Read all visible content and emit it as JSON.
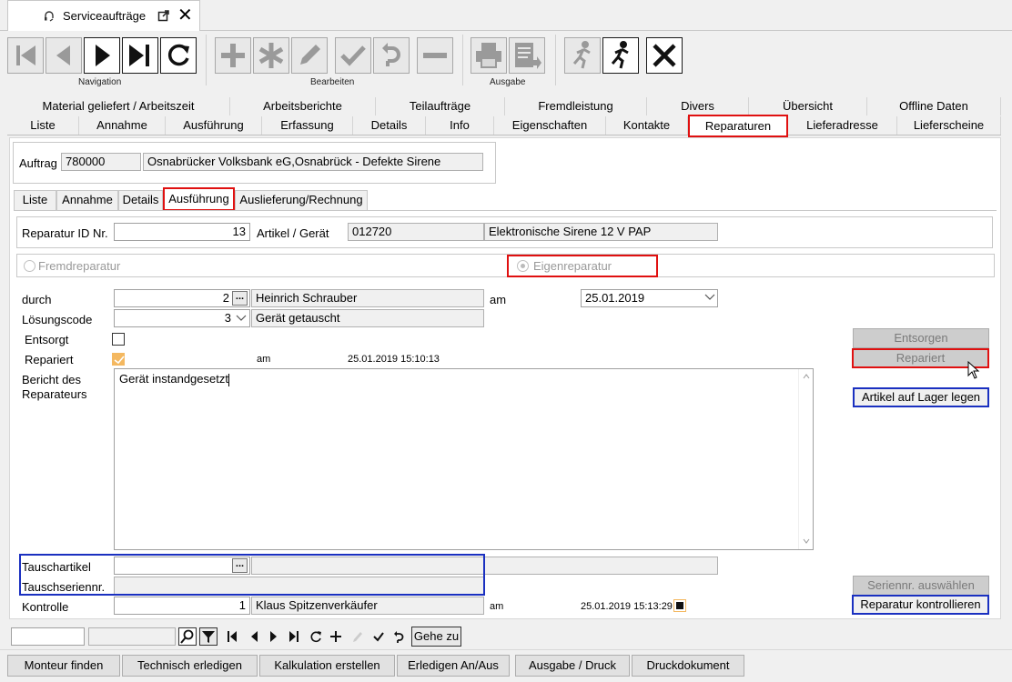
{
  "window": {
    "title": "Serviceaufträge"
  },
  "toolbar": {
    "groups": {
      "navigation": "Navigation",
      "bearbeiten": "Bearbeiten",
      "ausgabe": "Ausgabe"
    }
  },
  "tabs_row1": [
    "Material geliefert / Arbeitszeit",
    "Arbeitsberichte",
    "Teilaufträge",
    "Fremdleistung",
    "Divers",
    "Übersicht",
    "Offline Daten"
  ],
  "tabs_row2": [
    "Liste",
    "Annahme",
    "Ausführung",
    "Erfassung",
    "Details",
    "Info",
    "Eigenschaften",
    "Kontakte",
    "Reparaturen",
    "Lieferadresse",
    "Lieferscheine"
  ],
  "auftrag": {
    "label": "Auftrag",
    "nr": "780000",
    "text": "Osnabrücker Volksbank eG,Osnabrück - Defekte Sirene"
  },
  "subtabs": [
    "Liste",
    "Annahme",
    "Details",
    "Ausführung",
    "Auslieferung/Rechnung"
  ],
  "reparatur": {
    "id_label": "Reparatur ID Nr.",
    "id_value": "13",
    "artikel_label": "Artikel / Gerät",
    "artikel_nr": "012720",
    "artikel_text": "Elektronische Sirene 12 V PAP"
  },
  "radios": {
    "fremd": "Fremdreparatur",
    "eigen": "Eigenreparatur"
  },
  "form": {
    "durch_label": "durch",
    "durch_nr": "2",
    "durch_name": "Heinrich Schrauber",
    "am_label": "am",
    "am_date": "25.01.2019",
    "loesung_label": "Lösungscode",
    "loesung_nr": "3",
    "loesung_text": "Gerät getauscht",
    "entsorgt_label": "Entsorgt",
    "repariert_label": "Repariert",
    "repariert_am_label": "am",
    "repariert_am": "25.01.2019 15:10:13",
    "bericht_label1": "Bericht des",
    "bericht_label2": "Reparateurs",
    "bericht_text": "Gerät instandgesetzt",
    "tausch_label": "Tauschartikel",
    "tauschserien_label": "Tauschseriennr.",
    "kontrolle_label": "Kontrolle",
    "kontrolle_nr": "1",
    "kontrolle_name": "Klaus Spitzenverkäufer",
    "kontrolle_am_label": "am",
    "kontrolle_am": "25.01.2019 15:13:29"
  },
  "side_buttons": {
    "entsorgen": "Entsorgen",
    "repariert": "Repariert",
    "lager": "Artikel auf Lager legen",
    "seriennr": "Seriennr. auswählen",
    "kontrollieren": "Reparatur kontrollieren"
  },
  "navbar": {
    "gehe_zu": "Gehe zu"
  },
  "bottom_buttons": [
    "Monteur finden",
    "Technisch erledigen",
    "Kalkulation erstellen",
    "Erledigen An/Aus",
    "Ausgabe / Druck",
    "Druckdokument"
  ]
}
